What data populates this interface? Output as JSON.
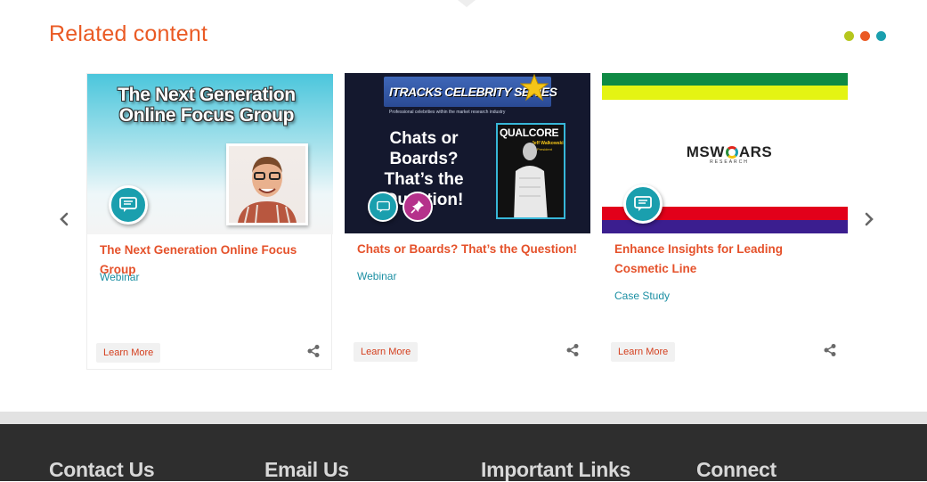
{
  "section": {
    "title": "Related content"
  },
  "pager_dots": [
    {
      "color": "#b5c61d"
    },
    {
      "color": "#ea5a24"
    },
    {
      "color": "#1a9fae"
    }
  ],
  "nav": {
    "prev_icon": "chevron-left-icon",
    "next_icon": "chevron-right-icon"
  },
  "cards": [
    {
      "title": "The Next Generation Online Focus Group",
      "type": "Webinar",
      "button": "Learn More",
      "image": {
        "headline_line1": "The Next Generation",
        "headline_line2": "Online Focus Group"
      }
    },
    {
      "title": "Chats or Boards? That’s the Question!",
      "type": "Webinar",
      "button": "Learn More",
      "image": {
        "banner": "ITRACKS CELEBRITY SERIES",
        "banner_sub": "Professional celebrities within the market research industry",
        "headline_line1": "Chats or Boards?",
        "headline_line2": "That’s the",
        "headline_line3": "Question!",
        "mag_title": "QUALCORE",
        "mag_name": "Jeff Walkowski",
        "mag_role": "President"
      }
    },
    {
      "title": "Enhance Insights for Leading Cosmetic Line",
      "type": "Case Study",
      "button": "Learn More",
      "image": {
        "logo_part1": "MSW",
        "logo_part2": "ARS",
        "logo_sub": "RESEARCH"
      }
    }
  ],
  "footer": {
    "columns": [
      "Contact Us",
      "Email Us",
      "Important Links",
      "Connect"
    ]
  }
}
